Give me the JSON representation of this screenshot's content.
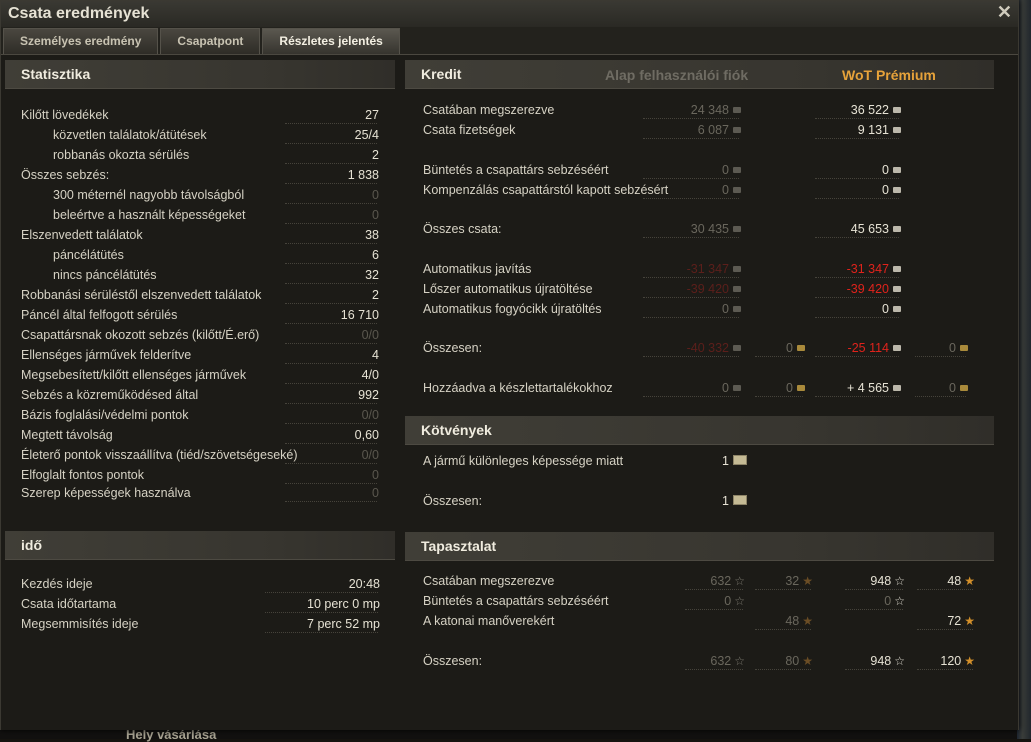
{
  "window": {
    "title": "Csata eredmények"
  },
  "tabs": [
    "Személyes eredmény",
    "Csapatpont",
    "Részletes jelentés"
  ],
  "statisztika": {
    "heading": "Statisztika",
    "rows": [
      {
        "label": "Kilőtt lövedékek",
        "value": "27",
        "indent": false,
        "dim": false
      },
      {
        "label": "közvetlen találatok/átütések",
        "value": "25/4",
        "indent": true,
        "dim": false
      },
      {
        "label": "robbanás okozta sérülés",
        "value": "2",
        "indent": true,
        "dim": false
      },
      {
        "label": "Összes sebzés:",
        "value": "1 838",
        "indent": false,
        "dim": false
      },
      {
        "label": "300 méternél nagyobb távolságból",
        "value": "0",
        "indent": true,
        "dim": true
      },
      {
        "label": "beleértve a használt képességeket",
        "value": "0",
        "indent": true,
        "dim": true
      },
      {
        "label": "Elszenvedett találatok",
        "value": "38",
        "indent": false,
        "dim": false
      },
      {
        "label": "páncélátütés",
        "value": "6",
        "indent": true,
        "dim": false
      },
      {
        "label": "nincs páncélátütés",
        "value": "32",
        "indent": true,
        "dim": false
      },
      {
        "label": "Robbanási sérüléstől elszenvedett találatok",
        "value": "2",
        "indent": false,
        "dim": false
      },
      {
        "label": "Páncél által felfogott sérülés",
        "value": "16 710",
        "indent": false,
        "dim": false
      },
      {
        "label": "Csapattársnak okozott sebzés (kilőtt/É.erő)",
        "value": "0/0",
        "indent": false,
        "dim": true
      },
      {
        "label": "Ellenséges járművek felderítve",
        "value": "4",
        "indent": false,
        "dim": false
      },
      {
        "label": "Megsebesített/kilőtt ellenséges járművek",
        "value": "4/0",
        "indent": false,
        "dim": false
      },
      {
        "label": "Sebzés a közreműködésed által",
        "value": "992",
        "indent": false,
        "dim": false
      },
      {
        "label": "Bázis foglalási/védelmi pontok",
        "value": "0/0",
        "indent": false,
        "dim": true
      },
      {
        "label": "Megtett távolság",
        "value": "0,60",
        "indent": false,
        "dim": false
      },
      {
        "label": "Életerő pontok visszaállítva (tiéd/szövetségeseké)",
        "value": "0/0",
        "indent": false,
        "dim": true
      },
      {
        "label": "Elfoglalt fontos pontok",
        "value": "0",
        "indent": false,
        "dim": true
      },
      {
        "label": "Szerep képességek használva",
        "value": "0",
        "indent": false,
        "dim": true
      }
    ]
  },
  "ido": {
    "heading": "idő",
    "rows": [
      {
        "label": "Kezdés ideje",
        "value": "20:48"
      },
      {
        "label": "Csata időtartama",
        "value": "10 perc 0 mp"
      },
      {
        "label": "Megsemmisítés ideje",
        "value": "7 perc 52 mp"
      }
    ]
  },
  "kredit": {
    "heading": "Kredit",
    "col_basic": "Alap felhasználói fiók",
    "col_premium": "WoT Prémium",
    "colors": {
      "premium_header": "#e6a23a",
      "basic_header": "#6f6c63",
      "negative": "#e0231c"
    },
    "rows": [
      {
        "label": "Csatában megszerezve",
        "basic": "24 348",
        "premium": "36 522"
      },
      {
        "label": "Csata fizetségek",
        "basic": "6 087",
        "premium": "9 131"
      },
      {
        "label": "Büntetés a csapattárs sebzéséért",
        "basic": "0",
        "premium": "0"
      },
      {
        "label": "Kompenzálás csapattárstól kapott sebzésért",
        "basic": "0",
        "premium": "0"
      },
      {
        "label": "Összes csata:",
        "basic": "30 435",
        "premium": "45 653"
      },
      {
        "label": "Automatikus javítás",
        "basic": "-31 347",
        "premium": "-31 347"
      },
      {
        "label": "Lőszer automatikus újratöltése",
        "basic": "-39 420",
        "premium": "-39 420"
      },
      {
        "label": "Automatikus fogyócikk újratöltés",
        "basic": "0",
        "premium": "0"
      },
      {
        "label": "Összesen:",
        "basic": "-40 332",
        "basic_gold": "0",
        "premium": "-25 114",
        "premium_gold": "0"
      },
      {
        "label": "Hozzáadva a készlettartalékokhoz",
        "basic": "0",
        "basic_gold": "0",
        "premium": "+ 4 565",
        "premium_gold": "0"
      }
    ]
  },
  "kotvenyek": {
    "heading": "Kötvények",
    "rows": [
      {
        "label": "A jármű különleges képessége miatt",
        "value": "1"
      },
      {
        "label": "Összesen:",
        "value": "1"
      }
    ]
  },
  "tapasztalat": {
    "heading": "Tapasztalat",
    "rows": [
      {
        "label": "Csatában megszerezve",
        "basic": "632",
        "basic_free": "32",
        "premium": "948",
        "premium_free": "48"
      },
      {
        "label": "Büntetés a csapattárs sebzéséért",
        "basic": "0",
        "premium": "0"
      },
      {
        "label": "A katonai manőverekért",
        "basic_free": "48",
        "premium_free": "72"
      },
      {
        "label": "Összesen:",
        "basic": "632",
        "basic_free": "80",
        "premium": "948",
        "premium_free": "120"
      }
    ]
  },
  "icons": {
    "credit": "credit-coin-icon",
    "gold": "gold-coin-icon",
    "xp": "xp-star-icon",
    "free_xp": "free-xp-star-icon",
    "bond": "bond-icon",
    "close": "close-icon"
  },
  "background": {
    "hint_text": "Hely vásárlása"
  }
}
